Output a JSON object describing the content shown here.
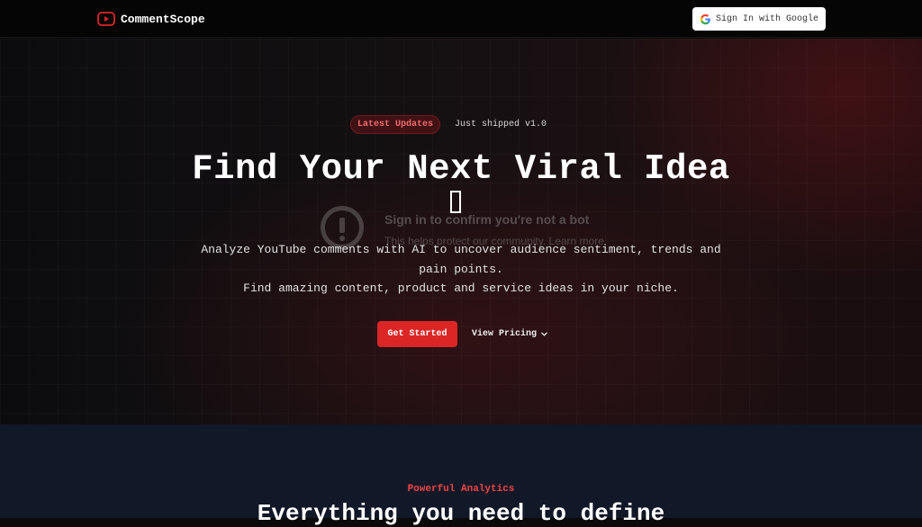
{
  "nav": {
    "brand_name": "CommentScope",
    "signin_label": "Sign In with Google"
  },
  "hero": {
    "badge": "Latest Updates",
    "badge_text": "Just shipped v1.0",
    "headline": "Find Your Next Viral Idea",
    "subtitle_line1": "Analyze YouTube comments with AI to uncover audience sentiment, trends and pain points.",
    "subtitle_line2": "Find amazing content, product and service ideas in your niche.",
    "cta_primary": "Get Started",
    "cta_secondary": "View Pricing"
  },
  "bot_overlay": {
    "title": "Sign in to confirm you're not a bot",
    "subtitle": "This helps protect our community. Learn more"
  },
  "features": {
    "eyebrow": "Powerful Analytics",
    "title": "Everything you need to define"
  },
  "colors": {
    "accent": "#dc2626",
    "accent_text": "#ef4444",
    "section_bg": "#111827",
    "nav_bg": "#050505"
  },
  "icons": {
    "brand": "youtube-play-icon",
    "google": "google-g-icon",
    "chevron": "chevron-down-icon",
    "alert": "alert-circle-icon"
  }
}
